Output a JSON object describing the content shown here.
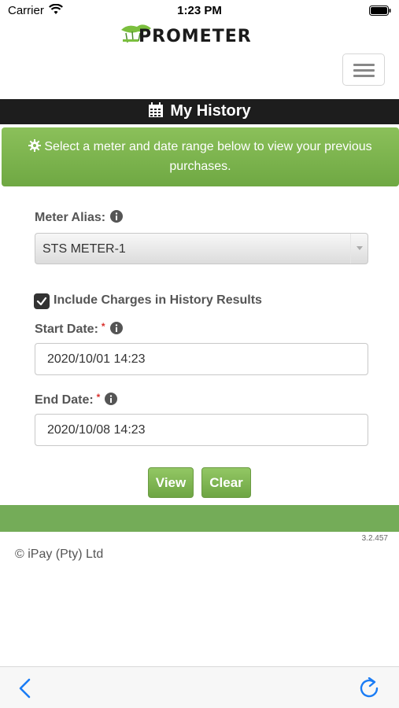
{
  "status_bar": {
    "carrier": "Carrier",
    "time": "1:23 PM"
  },
  "header": {
    "logo_text": "PROMETER",
    "menu_icon": "hamburger-menu-icon"
  },
  "title_bar": {
    "title": "My History",
    "icon": "calendar-icon"
  },
  "alert": {
    "text": "Select a meter and date range below to view your previous purchases.",
    "icon": "gear-icon"
  },
  "form": {
    "meter_alias_label": "Meter Alias:",
    "meter_alias_value": "STS METER-1",
    "include_charges_label": "Include Charges in History Results",
    "include_charges_checked": true,
    "start_date_label": "Start Date:",
    "start_date_value": "2020/10/01 14:23",
    "end_date_label": "End Date:",
    "end_date_value": "2020/10/08 14:23",
    "required_marker": "*"
  },
  "buttons": {
    "view": "View",
    "clear": "Clear"
  },
  "footer": {
    "version": "3.2.457",
    "copyright": "© iPay (Pty) Ltd"
  },
  "colors": {
    "accent_green": "#74ac58",
    "title_bar": "#1d1d1d",
    "required": "#d9302c"
  },
  "browser_toolbar": {
    "back_icon": "chevron-left-icon",
    "refresh_icon": "refresh-icon"
  }
}
